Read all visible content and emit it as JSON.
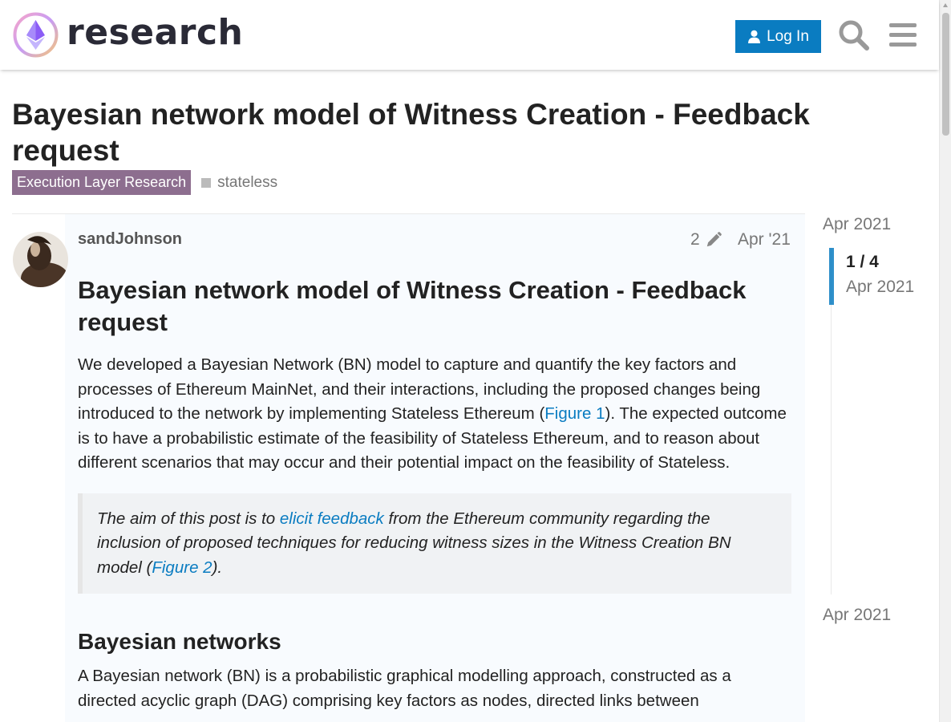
{
  "header": {
    "site_name": "research",
    "login_label": "Log In"
  },
  "topic": {
    "title": "Bayesian network model of Witness Creation - Feedback request",
    "category": "Execution Layer Research",
    "category_color": "#8d6e8f",
    "tag": "stateless"
  },
  "post": {
    "username": "sandJohnson",
    "edit_count": "2",
    "date": "Apr '21",
    "heading": "Bayesian network model of Witness Creation - Feedback request",
    "para1_a": "We developed a Bayesian Network (BN) model to capture and quantify the key factors and processes of Ethereum MainNet, and their interactions, including the proposed changes being introduced to the network by implementing Stateless Ethereum (",
    "para1_link": "Figure 1",
    "para1_b": "). The expected outcome is to have a probabilistic estimate of the feasibility of Stateless Ethereum, and to reason about different scenarios that may occur and their potential impact on the feasibility of Stateless.",
    "quote_a": "The aim of this post is to ",
    "quote_link1": "elicit feedback",
    "quote_b": " from the Ethereum community regarding the inclusion of proposed techniques for reducing witness sizes in the Witness Creation BN model (",
    "quote_link2": "Figure 2",
    "quote_c": ").",
    "section_heading": "Bayesian networks",
    "para2": "A Bayesian network (BN) is a probabilistic graphical modelling approach, constructed as a directed acyclic graph (DAG) comprising key factors as nodes, directed links between"
  },
  "timeline": {
    "top_date": "Apr 2021",
    "count": "1 / 4",
    "current_date": "Apr 2021",
    "bottom_date": "Apr 2021"
  },
  "colors": {
    "accent": "#0a7cc1"
  }
}
